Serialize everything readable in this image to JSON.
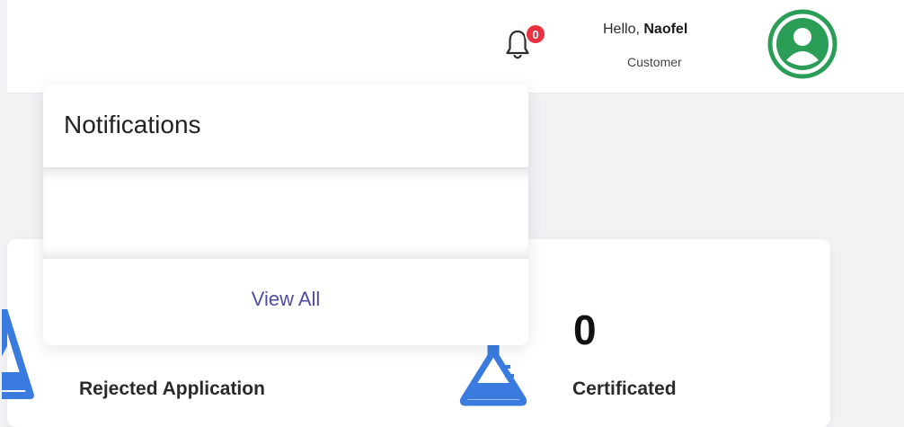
{
  "header": {
    "notification_count": "0",
    "greeting_prefix": "Hello, ",
    "user_name": "Naofel",
    "user_role": "Customer"
  },
  "notifications": {
    "title": "Notifications",
    "view_all_label": "View All"
  },
  "stats": {
    "rejected": {
      "value": "",
      "label": "Rejected Application"
    },
    "certificated": {
      "value": "0",
      "label": "Certificated"
    }
  },
  "colors": {
    "accent": "#4f4ea3",
    "badge": "#e8323f",
    "avatar": "#2a9d57",
    "flask": "#3a7be0"
  },
  "icons": {
    "notification": "bell-icon",
    "avatar": "user-avatar-icon",
    "stat": "flask-icon"
  }
}
